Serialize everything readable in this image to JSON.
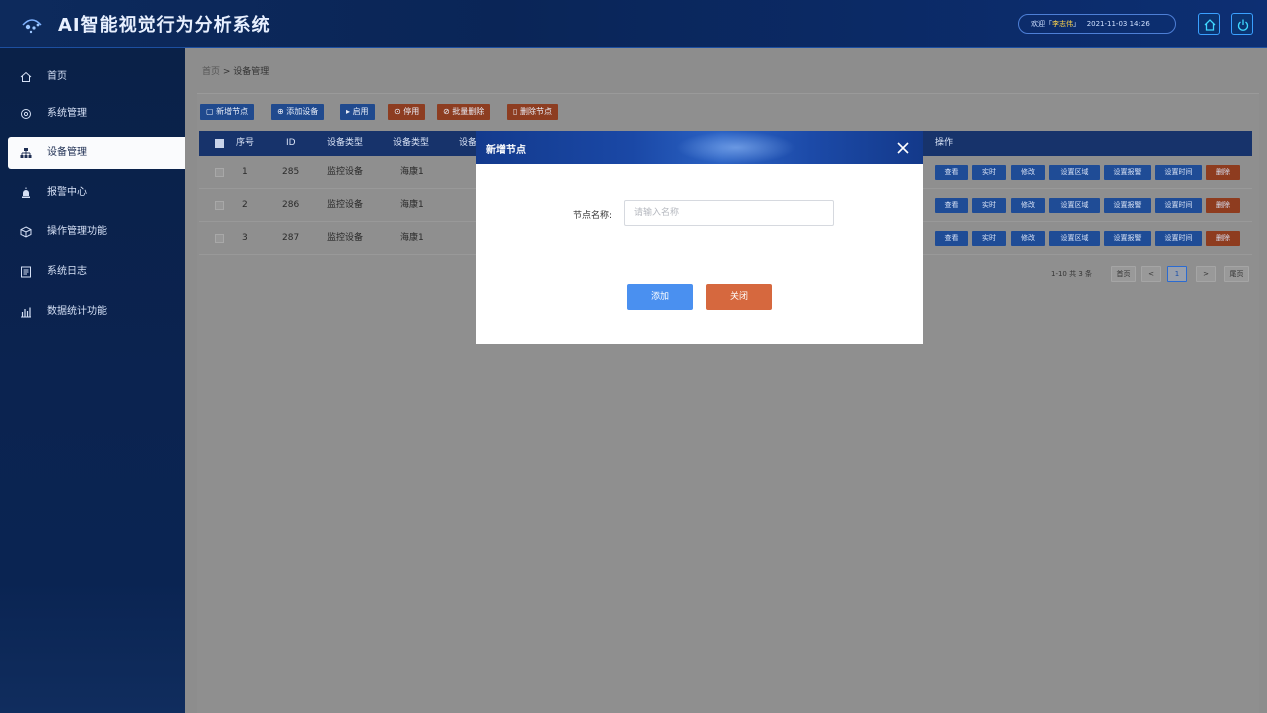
{
  "header": {
    "title": "AI智能视觉行为分析系统",
    "welcome_prefix": "欢迎「",
    "user_name": "李志伟",
    "welcome_suffix": "」",
    "datetime": "2021-11-03  14:26"
  },
  "sidebar": {
    "items": [
      {
        "label": "首页",
        "icon": "home-icon"
      },
      {
        "label": "系统管理",
        "icon": "gear-icon"
      },
      {
        "label": "设备管理",
        "icon": "device-tree-icon",
        "active": true
      },
      {
        "label": "报警中心",
        "icon": "alarm-icon"
      },
      {
        "label": "操作管理功能",
        "icon": "cube-icon"
      },
      {
        "label": "系统日志",
        "icon": "log-icon"
      },
      {
        "label": "数据统计功能",
        "icon": "chart-icon"
      }
    ]
  },
  "breadcrumb": {
    "home": "首页",
    "sep": " > ",
    "current": "设备管理"
  },
  "toolbar": {
    "add_node": "新增节点",
    "add_device": "添加设备",
    "enable": "启用",
    "disable": "停用",
    "batch_delete": "批量删除",
    "delete_node": "删除节点"
  },
  "table": {
    "headers": [
      "序号",
      "ID",
      "设备类型",
      "设备类型",
      "设备",
      "操作"
    ],
    "rows": [
      {
        "index": "1",
        "id": "285",
        "type": "监控设备",
        "brand": "海康1"
      },
      {
        "index": "2",
        "id": "286",
        "type": "监控设备",
        "brand": "海康1"
      },
      {
        "index": "3",
        "id": "287",
        "type": "监控设备",
        "brand": "海康1"
      }
    ],
    "actions": [
      "查看",
      "实时",
      "修改",
      "设置区域",
      "设置报警",
      "设置时间",
      "删除"
    ]
  },
  "pagination": {
    "summary": "1-10 共 3 条",
    "first": "首页",
    "prev": "<",
    "current": "1",
    "next": ">",
    "last": "尾页"
  },
  "modal": {
    "title": "新增节点",
    "field_label": "节点名称:",
    "field_placeholder": "请输入名称",
    "field_value": "",
    "confirm": "添加",
    "close": "关闭"
  },
  "colors": {
    "header_bg": "#0b2a66",
    "sidebar_bg": "#0a2148",
    "primary_button": "#4a90f0",
    "close_button": "#d6683e",
    "table_header": "#17336b"
  }
}
